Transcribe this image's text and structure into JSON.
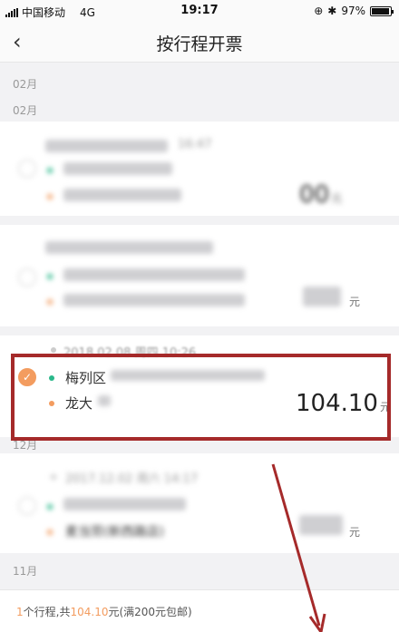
{
  "status": {
    "carrier": "中国移动",
    "network": "4G",
    "time": "19:17",
    "battery": "97%",
    "battery_level": 0.97
  },
  "nav": {
    "title": "按行程开票",
    "back_icon": "chevron-left-icon"
  },
  "months": {
    "m1": "02月",
    "m2": "02月",
    "m3": "12月",
    "m4": "11月"
  },
  "trips": [
    {
      "date": "16:47",
      "amount": "00",
      "unit": "元"
    },
    {
      "date": "",
      "amount": "",
      "unit": "元"
    },
    {
      "date": "2018.02.08 周四 10:26",
      "from": "梅列区",
      "to": "龙大",
      "amount": "104.10",
      "unit": "元",
      "selected": true
    },
    {
      "date": "2017.12.02 周六 14:17",
      "to": "麦当劳(新西路店)",
      "amount": "",
      "unit": "元"
    }
  ],
  "footer": {
    "count": "1",
    "count_suffix": "个行程,共",
    "total": "104.10",
    "total_suffix": "元(满200元包邮)"
  },
  "colors": {
    "accent": "#f39c5f",
    "start_dot": "#2ab88a",
    "annotation": "#a52a2a"
  }
}
